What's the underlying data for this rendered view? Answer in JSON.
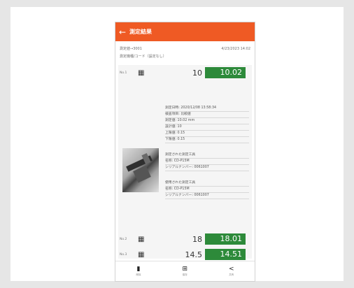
{
  "app": {
    "title": "測定結果",
    "back_icon": "arrow-left-icon",
    "accent": "#ef5a24",
    "value_bg": "#2d8a3a"
  },
  "meta": {
    "left1": "測定値→3001",
    "right1": "4/23/2023 14:02",
    "left2": "測定機種/コード（設定なし）"
  },
  "measurements": [
    {
      "no": "No.1",
      "reference": "10",
      "value": "10.02"
    },
    {
      "no": "No.2",
      "reference": "18",
      "value": "18.01"
    },
    {
      "no": "No.3",
      "reference": "14.5",
      "value": "14.51"
    }
  ],
  "details": {
    "lines1": [
      "測定日時: 2020/12/08 13:58:34",
      "検査項目: 比較値",
      "測定値: 10.02 mm",
      "設計値: 10",
      "上限値: 0.15",
      "下限値: 0.15"
    ],
    "lines2": [
      "測定された測定工具",
      "名称: CD-P15M",
      "シリアルナンバー: 0061007"
    ],
    "lines3": [
      "使用された測定工具",
      "名称: CD-P15M",
      "シリアルナンバー: 0061007"
    ]
  },
  "bottom_nav": [
    {
      "icon": "delete-icon",
      "label": "削除"
    },
    {
      "icon": "save-icon",
      "label": "保存"
    },
    {
      "icon": "share-icon",
      "label": "共有"
    }
  ]
}
